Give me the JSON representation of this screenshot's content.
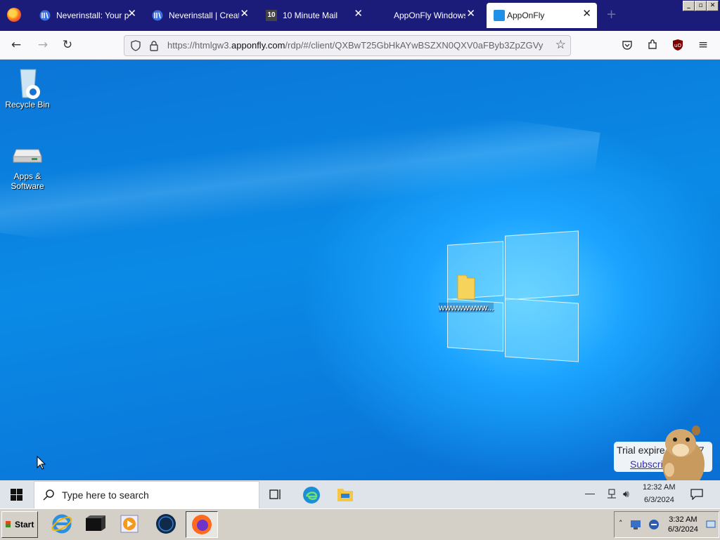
{
  "browser": {
    "tabs": [
      {
        "label": "Neverinstall: Your per",
        "close": "✕"
      },
      {
        "label": "Neverinstall | Create",
        "close": "✕"
      },
      {
        "label": "10 Minute Mail",
        "close": "✕",
        "icon_text": "10"
      },
      {
        "label": "AppOnFly Windows V",
        "close": "✕"
      },
      {
        "label": "AppOnFly",
        "close": "✕"
      }
    ],
    "new_tab": "+",
    "url_prefix": "https://htmlgw3.",
    "url_domain": "apponfly.com",
    "url_path": "/rdp/#/client/QXBwT25GbHkAYwBSZXN0QXV0aFByb3ZpZGVy",
    "window_controls": [
      "_",
      "▫",
      "✕"
    ]
  },
  "desktop": {
    "icons": [
      {
        "label": "Recycle Bin"
      },
      {
        "label": "Apps & Software"
      },
      {
        "label": "wwwwwwww..."
      }
    ]
  },
  "taskbar_win10": {
    "search_placeholder": "Type here to search",
    "time": "12:32 AM",
    "date": "6/3/2024"
  },
  "taskbar_classic": {
    "start_label": "Start",
    "time": "3:32 AM",
    "date": "6/3/2024"
  },
  "trial_popup": {
    "line1": "Trial expire",
    "line1_suffix": "7",
    "link": "Subscri"
  },
  "colors": {
    "tabbar": "#1b1b7a",
    "desktop": "#0b62c9"
  }
}
